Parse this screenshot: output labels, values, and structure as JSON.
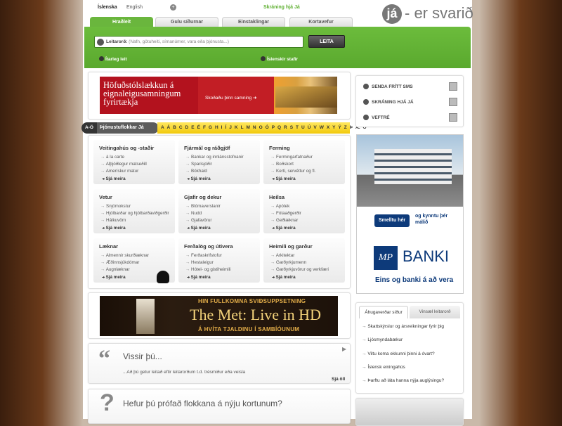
{
  "lang": {
    "icelandic": "Íslenska",
    "english": "English"
  },
  "header": {
    "register_link": "Skráning hjá Já",
    "logo_main": "já",
    "logo_tagline": "- er svarið"
  },
  "tabs": [
    {
      "label": "Hraðleit"
    },
    {
      "label": "Gulu síðurnar"
    },
    {
      "label": "Einstaklingar"
    },
    {
      "label": "Kortavefur"
    }
  ],
  "search": {
    "label": "Leitarorð:",
    "placeholder": "(Nafn, götuheiti, símanúmer, vara eða þjónusta...)",
    "button": "LEITA"
  },
  "options": {
    "advanced": "Ítarleg leit",
    "icelandic_chars": "Íslenskir stafir"
  },
  "ad_top": {
    "text": "Höfuðstólslækkun á eignaleigusamningum fyrirtækja",
    "button": "Skoðaðu þinn samning"
  },
  "alphabet": {
    "badge": "A-Ö",
    "label": "Þjónustuflokkar Já",
    "letters": "A Á B C D E É F G H I Í J K L M N O Ó P Q R S T U Ú V W X Y Ý Z Þ Æ Ö"
  },
  "categories": [
    {
      "title": "Veitingahús og -staðir",
      "items": [
        "á la carte",
        "Alþjóðlegur matseðill",
        "Amerískur matur"
      ],
      "more": "Sjá meira"
    },
    {
      "title": "Fjármál og ráðgjöf",
      "items": [
        "Bankar og innlánsstofnanir",
        "Sparisjóðir",
        "Bókhald"
      ],
      "more": "Sjá meira"
    },
    {
      "title": "Ferming",
      "items": [
        "Fermingarfatnaður",
        "Boðskort",
        "Kerti, servéttur og fl."
      ],
      "more": "Sjá meira"
    },
    {
      "title": "Vetur",
      "items": [
        "Snjómokstur",
        "Hjólbarðar og hjólbarðaviðgerðir",
        "Hálkuvörn"
      ],
      "more": "Sjá meira"
    },
    {
      "title": "Gjafir og dekur",
      "items": [
        "Blómaverslanir",
        "Nudd",
        "Gjafavörur"
      ],
      "more": "Sjá meira"
    },
    {
      "title": "Heilsa",
      "items": [
        "Apótek",
        "Fótaaðgerðir",
        "Geðlæknar"
      ],
      "more": "Sjá meira"
    },
    {
      "title": "Læknar",
      "items": [
        "Almennir skurðlæknar",
        "Æðinnsjúkdómar",
        "Augnlæknar"
      ],
      "more": "Sjá meira"
    },
    {
      "title": "Ferðalög og útivera",
      "items": [
        "Ferðaskrifstofur",
        "Hestaleigur",
        "Hótel- og gistiheimili"
      ],
      "more": "Sjá meira"
    },
    {
      "title": "Heimili og garður",
      "items": [
        "Arkitektar",
        "Garðyrkjumenn",
        "Garðyrkjuvörur og verkfæri"
      ],
      "more": "Sjá meira"
    }
  ],
  "ad_met": {
    "top": "HIN FULLKOMNA SVIÐSUPPSETNING",
    "title": "The Met: Live in HD",
    "bottom": "Á HVÍTA TJALDINU Í SAMBÍÓUNUM"
  },
  "did_you_know": {
    "title": "Vissir þú...",
    "text": "...Að þú getur leitað eftir leitarorðum t.d. trésmiður eða veisla",
    "link": "Sjá öll"
  },
  "tried": {
    "title": "Hefur þú prófað flokkana á nýju kortunum?"
  },
  "side_links": [
    {
      "label": "SENDA FRÍTT SMS"
    },
    {
      "label": "SKRÁNING HJÁ JÁ"
    },
    {
      "label": "VEFTRÉ"
    }
  ],
  "bank_ad": {
    "button": "Smelltu hér",
    "pitch": "og kynntu þér málið",
    "bank": "BANKI",
    "logo": "MP",
    "slogan": "Eins og banki á að vera"
  },
  "right_tabs": {
    "tab1": "Áhugaverðar síður",
    "tab2": "Vinsæl leitarorð",
    "items": [
      "Skattskýrslur og ársreikningar fyrir þig",
      "Ljósmyndabækur",
      "Viltu koma ekkunni þinni á óvart?",
      "Íslensk einingahús",
      "Þarftu að láta hanna nýja auglýsingu?"
    ]
  },
  "colors": {
    "green": "#5fb032",
    "yellow": "#f5d41a",
    "dark": "#333333",
    "bank_blue": "#0d3a7a"
  }
}
